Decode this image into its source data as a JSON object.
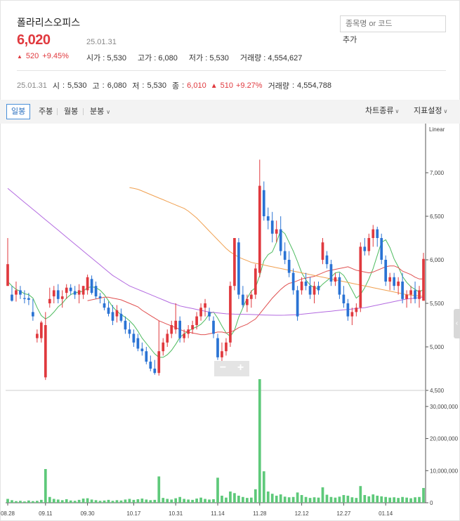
{
  "header": {
    "stock_name": "폴라리스오피스",
    "price": "6,020",
    "date": "25.01.31",
    "change": "520",
    "change_pct": "+9.45%",
    "open_label": "시가",
    "open": "5,530",
    "high_label": "고가",
    "high": "6,080",
    "low_label": "저가",
    "low": "5,530",
    "volume_label": "거래량",
    "volume": "4,554,627"
  },
  "search": {
    "placeholder": "종목명 or 코드",
    "add_label": "추가"
  },
  "daily_summary": {
    "date": "25.01.31",
    "open_label": "시",
    "open": "5,530",
    "high_label": "고",
    "high": "6,080",
    "low_label": "저",
    "low": "5,530",
    "close_label": "종",
    "close": "6,010",
    "change": "510",
    "change_pct": "+9.27%",
    "volume_label": "거래량",
    "volume": "4,554,788"
  },
  "toolbar": {
    "tabs": [
      "일봉",
      "주봉",
      "월봉",
      "분봉"
    ],
    "active_tab": "일봉",
    "chart_type_label": "차트종류",
    "indicator_label": "지표설정"
  },
  "colors": {
    "up": "#e0393e",
    "down": "#2a73d4",
    "volume": "#5ec97a",
    "ma5": "#4dbb5f",
    "ma20": "#e05050",
    "ma60": "#f0a050",
    "ma120": "#b36ae0"
  },
  "chart_data": {
    "type": "candlestick",
    "scale_label": "Linear",
    "price_ticks": [
      "7,000",
      "6,500",
      "6,000",
      "5,500",
      "5,000",
      "4,500"
    ],
    "price_ylim": [
      4500,
      7500
    ],
    "volume_ticks": [
      "30,000,000",
      "20,000,000",
      "10,000,000",
      "0"
    ],
    "volume_ylim": [
      0,
      35000000
    ],
    "x_ticks": [
      "08.28",
      "09.11",
      "09.30",
      "10.17",
      "10.31",
      "11.14",
      "11.28",
      "12.12",
      "12.27",
      "01.14"
    ],
    "x_tick_index": [
      0,
      9,
      19,
      30,
      40,
      50,
      60,
      70,
      80,
      90
    ],
    "candles": [
      [
        5700,
        6250,
        5700,
        5950
      ],
      [
        5600,
        5700,
        5520,
        5530
      ],
      [
        5600,
        5750,
        5520,
        5650
      ],
      [
        5650,
        5700,
        5550,
        5600
      ],
      [
        5560,
        5650,
        5500,
        5550
      ],
      [
        5560,
        5620,
        5480,
        5540
      ],
      [
        5400,
        5550,
        5300,
        5350
      ],
      [
        5100,
        5200,
        5050,
        5150
      ],
      [
        5100,
        5300,
        5050,
        5280
      ],
      [
        4650,
        5400,
        4620,
        5250
      ],
      [
        5500,
        5680,
        5450,
        5550
      ],
      [
        5580,
        5700,
        5500,
        5650
      ],
      [
        5650,
        5720,
        5500,
        5550
      ],
      [
        5550,
        5650,
        5450,
        5580
      ],
      [
        5620,
        5720,
        5550,
        5680
      ],
      [
        5680,
        5720,
        5600,
        5640
      ],
      [
        5640,
        5700,
        5550,
        5600
      ],
      [
        5600,
        5720,
        5500,
        5650
      ],
      [
        5600,
        5700,
        5550,
        5700
      ],
      [
        5650,
        5830,
        5600,
        5800
      ],
      [
        5780,
        5820,
        5600,
        5620
      ],
      [
        5700,
        5750,
        5550,
        5580
      ],
      [
        5580,
        5620,
        5500,
        5560
      ],
      [
        5500,
        5560,
        5420,
        5450
      ],
      [
        5450,
        5520,
        5350,
        5380
      ],
      [
        5400,
        5480,
        5250,
        5300
      ],
      [
        5350,
        5480,
        5280,
        5420
      ],
      [
        5380,
        5440,
        5280,
        5300
      ],
      [
        5300,
        5350,
        5150,
        5200
      ],
      [
        5200,
        5280,
        5100,
        5150
      ],
      [
        5150,
        5200,
        5000,
        5050
      ],
      [
        5100,
        5150,
        4950,
        4980
      ],
      [
        4980,
        5050,
        4900,
        4950
      ],
      [
        4950,
        5000,
        4800,
        4830
      ],
      [
        4830,
        4900,
        4720,
        4750
      ],
      [
        4750,
        4850,
        4680,
        4700
      ],
      [
        4700,
        5300,
        4670,
        4950
      ],
      [
        4950,
        5100,
        4900,
        5050
      ],
      [
        5050,
        5200,
        5000,
        5150
      ],
      [
        5150,
        5300,
        5100,
        5250
      ],
      [
        5200,
        5500,
        5150,
        5300
      ],
      [
        5300,
        5350,
        5050,
        5100
      ],
      [
        5100,
        5200,
        5050,
        5150
      ],
      [
        5150,
        5250,
        5100,
        5200
      ],
      [
        5200,
        5300,
        5150,
        5250
      ],
      [
        5250,
        5400,
        5200,
        5350
      ],
      [
        5350,
        5500,
        5300,
        5450
      ],
      [
        5450,
        5550,
        5350,
        5500
      ],
      [
        5400,
        5450,
        5300,
        5350
      ],
      [
        5300,
        5350,
        5100,
        5150
      ],
      [
        5100,
        5150,
        4850,
        4880
      ],
      [
        4880,
        5050,
        4800,
        4950
      ],
      [
        4950,
        5100,
        4900,
        5050
      ],
      [
        5050,
        5750,
        5000,
        5700
      ],
      [
        5700,
        6250,
        5650,
        6250
      ],
      [
        6200,
        6250,
        5550,
        5600
      ],
      [
        5600,
        5700,
        5450,
        5480
      ],
      [
        5480,
        5600,
        5400,
        5550
      ],
      [
        5550,
        5650,
        5450,
        5600
      ],
      [
        5600,
        5950,
        5550,
        5900
      ],
      [
        5850,
        7150,
        5800,
        6850
      ],
      [
        6800,
        6900,
        6450,
        6500
      ],
      [
        6500,
        6600,
        6350,
        6450
      ],
      [
        6450,
        6550,
        6200,
        6300
      ],
      [
        6300,
        6450,
        6200,
        6350
      ],
      [
        6350,
        6500,
        6050,
        6100
      ],
      [
        6100,
        6200,
        5950,
        6000
      ],
      [
        6000,
        6100,
        5800,
        5850
      ],
      [
        5850,
        5900,
        5600,
        5650
      ],
      [
        5650,
        5700,
        5300,
        5350
      ],
      [
        5650,
        5800,
        5600,
        5750
      ],
      [
        5750,
        5850,
        5650,
        5700
      ],
      [
        5700,
        5800,
        5550,
        5600
      ],
      [
        5600,
        5750,
        5500,
        5700
      ],
      [
        5700,
        5750,
        5600,
        5650
      ],
      [
        6000,
        6250,
        5950,
        6200
      ],
      [
        6050,
        6100,
        5900,
        5950
      ],
      [
        5950,
        6000,
        5700,
        5750
      ],
      [
        5750,
        5850,
        5700,
        5800
      ],
      [
        5800,
        5850,
        5550,
        5600
      ],
      [
        5600,
        5700,
        5450,
        5500
      ],
      [
        5500,
        5550,
        5300,
        5350
      ],
      [
        5350,
        5450,
        5250,
        5400
      ],
      [
        5400,
        5500,
        5350,
        5450
      ],
      [
        5450,
        6200,
        5400,
        6150
      ],
      [
        6150,
        6250,
        6050,
        6100
      ],
      [
        6100,
        6300,
        6050,
        6250
      ],
      [
        6250,
        6400,
        6150,
        6350
      ],
      [
        6350,
        6380,
        6150,
        6250
      ],
      [
        6250,
        6300,
        5950,
        6000
      ],
      [
        6000,
        6050,
        5700,
        5750
      ],
      [
        5750,
        5850,
        5650,
        5800
      ],
      [
        5800,
        5850,
        5650,
        5700
      ],
      [
        5700,
        5800,
        5600,
        5750
      ],
      [
        5750,
        5850,
        5500,
        5550
      ],
      [
        5550,
        5650,
        5450,
        5600
      ],
      [
        5600,
        5700,
        5500,
        5650
      ],
      [
        5650,
        5750,
        5500,
        5550
      ],
      [
        5550,
        5700,
        5450,
        5650
      ],
      [
        5530,
        6080,
        5530,
        6010
      ]
    ],
    "volumes": [
      1.2,
      0.8,
      0.5,
      0.6,
      0.4,
      0.7,
      0.5,
      0.6,
      0.9,
      10.5,
      1.8,
      1.2,
      1.0,
      0.8,
      1.1,
      0.7,
      0.6,
      0.9,
      1.3,
      1.4,
      1.0,
      0.8,
      0.6,
      0.7,
      0.9,
      0.6,
      0.8,
      0.7,
      1.0,
      1.2,
      0.9,
      1.1,
      1.3,
      1.0,
      0.8,
      0.9,
      8.2,
      1.5,
      1.2,
      1.0,
      1.4,
      1.8,
      1.2,
      1.0,
      0.9,
      1.3,
      1.6,
      1.2,
      1.0,
      1.1,
      7.8,
      2.2,
      1.6,
      3.5,
      3.0,
      2.2,
      1.8,
      1.5,
      1.6,
      4.2,
      38.5,
      9.8,
      3.5,
      2.8,
      2.2,
      2.6,
      1.9,
      1.7,
      1.8,
      3.2,
      2.4,
      1.8,
      1.5,
      1.7,
      1.6,
      4.8,
      2.5,
      1.8,
      1.6,
      1.9,
      2.4,
      2.2,
      1.7,
      1.5,
      5.2,
      2.4,
      2.0,
      2.6,
      2.2,
      2.0,
      1.8,
      1.6,
      1.7,
      1.5,
      1.8,
      1.6,
      1.4,
      1.7,
      1.8,
      4.6
    ],
    "moving_averages": [
      {
        "name": "ma5",
        "values": [
          5750,
          5700,
          5660,
          5640,
          5610,
          5600,
          5560,
          5450,
          5360,
          5320,
          5350,
          5400,
          5460,
          5500,
          5560,
          5600,
          5620,
          5630,
          5640,
          5680,
          5690,
          5680,
          5650,
          5600,
          5530,
          5460,
          5410,
          5370,
          5340,
          5300,
          5250,
          5180,
          5100,
          5040,
          4980,
          4920,
          4880,
          4880,
          4910,
          4960,
          5030,
          5110,
          5150,
          5180,
          5210,
          5230,
          5260,
          5310,
          5380,
          5400,
          5330,
          5240,
          5160,
          5120,
          5190,
          5340,
          5450,
          5560,
          5640,
          5680,
          5820,
          5990,
          6060,
          6090,
          6200,
          6340,
          6300,
          6200,
          6100,
          5980,
          5850,
          5770,
          5710,
          5680,
          5670,
          5720,
          5760,
          5800,
          5850,
          5860,
          5820,
          5740,
          5650,
          5560,
          5600,
          5680,
          5780,
          5900,
          6050,
          6200,
          6230,
          6140,
          6010,
          5920,
          5810,
          5740,
          5690,
          5660,
          5630,
          5660
        ]
      },
      {
        "name": "ma20",
        "values": [
          null,
          null,
          null,
          null,
          null,
          null,
          null,
          null,
          null,
          null,
          null,
          null,
          null,
          null,
          null,
          null,
          null,
          null,
          null,
          5530,
          5540,
          5550,
          5560,
          5570,
          5570,
          5560,
          5550,
          5540,
          5520,
          5500,
          5480,
          5460,
          5420,
          5390,
          5360,
          5330,
          5300,
          5280,
          5260,
          5240,
          5220,
          5200,
          5180,
          5170,
          5160,
          5150,
          5140,
          5140,
          5150,
          5160,
          5170,
          5170,
          5160,
          5170,
          5190,
          5220,
          5240,
          5260,
          5290,
          5320,
          5380,
          5440,
          5500,
          5560,
          5610,
          5660,
          5700,
          5730,
          5740,
          5760,
          5780,
          5790,
          5800,
          5810,
          5830,
          5850,
          5870,
          5880,
          5890,
          5900,
          5910,
          5920,
          5900,
          5880,
          5870,
          5860,
          5850,
          5860,
          5880,
          5900,
          5920,
          5930,
          5930,
          5910,
          5870,
          5850,
          5830,
          5800,
          5780,
          5780
        ]
      },
      {
        "name": "ma60",
        "values": [
          null,
          null,
          null,
          null,
          null,
          null,
          null,
          null,
          null,
          null,
          null,
          null,
          null,
          null,
          null,
          null,
          null,
          null,
          null,
          null,
          null,
          null,
          null,
          null,
          null,
          null,
          null,
          null,
          null,
          6830,
          6820,
          6810,
          6790,
          6770,
          6750,
          6730,
          6710,
          6690,
          6670,
          6650,
          6630,
          6610,
          6590,
          6560,
          6520,
          6480,
          6430,
          6380,
          6330,
          6280,
          6230,
          6180,
          6130,
          6090,
          6060,
          6030,
          6010,
          5990,
          5970,
          5960,
          5950,
          5940,
          5930,
          5920,
          5910,
          5900,
          5890,
          5880,
          5870,
          5860,
          5850,
          5840,
          5830,
          5820,
          5810,
          5800,
          5790,
          5780,
          5770,
          5760,
          5750,
          5740,
          5730,
          5720,
          5710,
          5700,
          5690,
          5680,
          5670,
          5660,
          5650,
          5640,
          5630,
          5620,
          5610,
          5600,
          5595,
          5590,
          5585,
          5580
        ]
      },
      {
        "name": "ma120",
        "values": [
          6820,
          6780,
          6740,
          6700,
          6660,
          6620,
          6580,
          6540,
          6500,
          6460,
          6420,
          6380,
          6340,
          6300,
          6260,
          6220,
          6180,
          6140,
          6100,
          6060,
          6020,
          5980,
          5940,
          5900,
          5860,
          5820,
          5790,
          5760,
          5730,
          5700,
          5680,
          5660,
          5640,
          5620,
          5600,
          5580,
          5560,
          5540,
          5520,
          5500,
          5490,
          5470,
          5460,
          5450,
          5440,
          5430,
          5420,
          5410,
          5400,
          5395,
          5390,
          5385,
          5380,
          5378,
          5376,
          5375,
          5374,
          5373,
          5372,
          5370,
          5368,
          5366,
          5365,
          5364,
          5363,
          5363,
          5364,
          5366,
          5368,
          5370,
          5375,
          5380,
          5385,
          5390,
          5395,
          5400,
          5405,
          5410,
          5415,
          5420,
          5425,
          5430,
          5435,
          5440,
          5445,
          5450,
          5460,
          5470,
          5480,
          5490,
          5500,
          5510,
          5520,
          5530,
          5540,
          5550,
          5555,
          5560,
          5565,
          5570
        ]
      }
    ]
  }
}
